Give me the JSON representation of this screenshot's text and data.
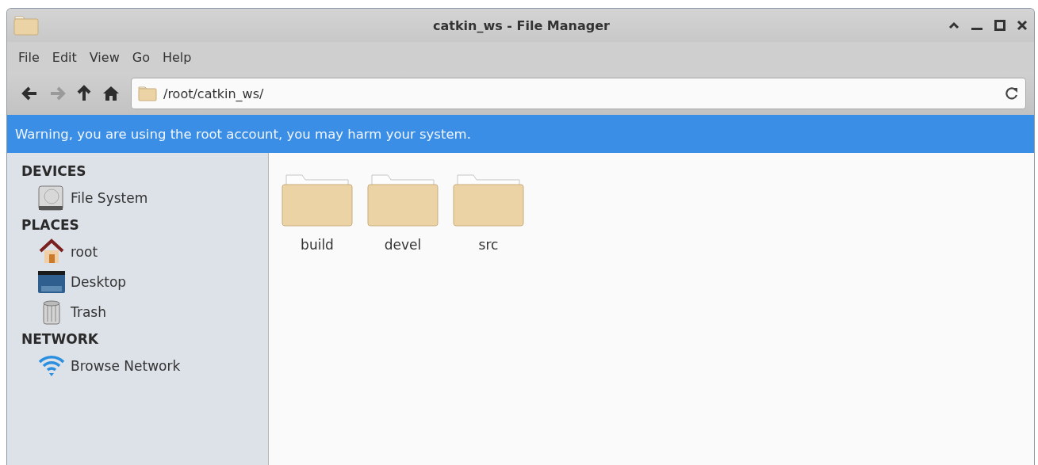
{
  "window": {
    "title": "catkin_ws - File Manager"
  },
  "menu": [
    "File",
    "Edit",
    "View",
    "Go",
    "Help"
  ],
  "nav": [
    {
      "kind": "back",
      "disabled": false
    },
    {
      "kind": "forward",
      "disabled": true
    },
    {
      "kind": "up",
      "disabled": false
    },
    {
      "kind": "home",
      "disabled": false
    }
  ],
  "location": {
    "value": "/root/catkin_ws/"
  },
  "warning": "Warning, you are using the root account, you may harm your system.",
  "sidebar": [
    {
      "heading": "DEVICES",
      "items": [
        {
          "label": "File System",
          "kind": "drive"
        }
      ]
    },
    {
      "heading": "PLACES",
      "items": [
        {
          "label": "root",
          "kind": "home"
        },
        {
          "label": "Desktop",
          "kind": "desktop"
        },
        {
          "label": "Trash",
          "kind": "trash"
        }
      ]
    },
    {
      "heading": "NETWORK",
      "items": [
        {
          "label": "Browse Network",
          "kind": "network"
        }
      ]
    }
  ],
  "files": [
    {
      "name": "build"
    },
    {
      "name": "devel"
    },
    {
      "name": "src"
    }
  ]
}
